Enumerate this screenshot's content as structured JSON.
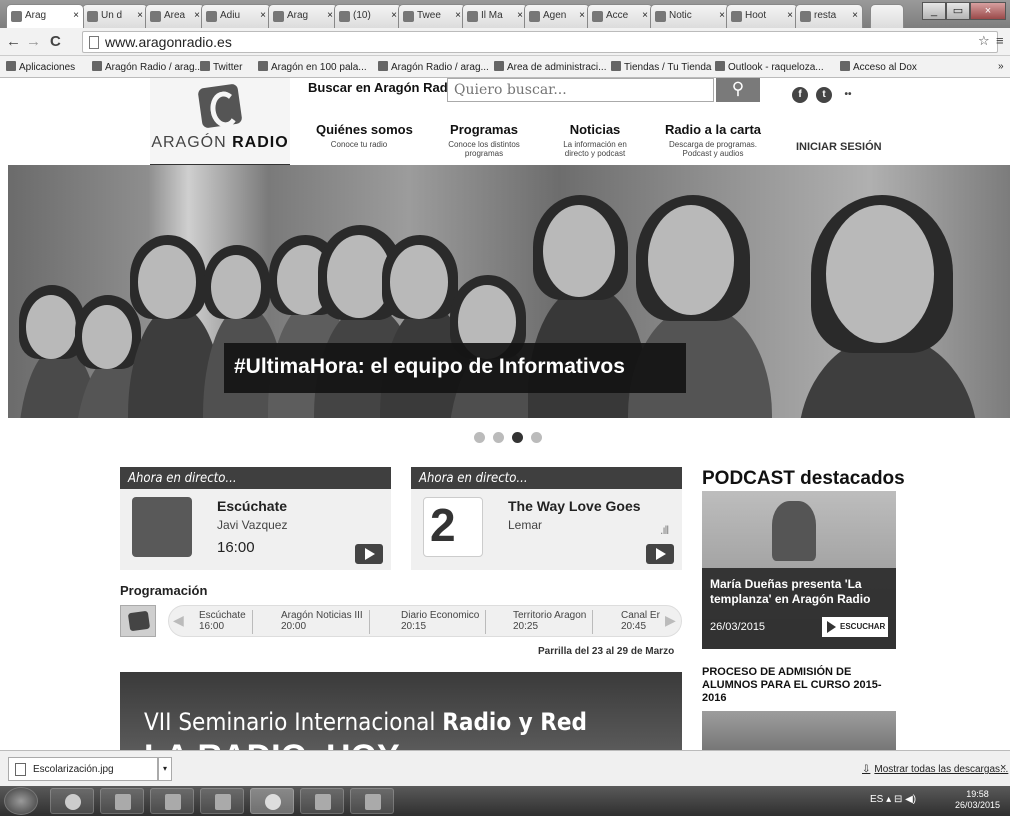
{
  "browser": {
    "tabs": [
      {
        "label": "Arag"
      },
      {
        "label": "Un d"
      },
      {
        "label": "Area"
      },
      {
        "label": "Adiu"
      },
      {
        "label": "Arag"
      },
      {
        "label": "(10)"
      },
      {
        "label": "Twee"
      },
      {
        "label": "Il Ma"
      },
      {
        "label": "Agen"
      },
      {
        "label": "Acce"
      },
      {
        "label": "Notic"
      },
      {
        "label": "Hoot"
      },
      {
        "label": "resta"
      }
    ],
    "url": "www.aragonradio.es",
    "bookmarks": [
      "Aplicaciones",
      "Aragón Radio / arag...",
      "Twitter",
      "Aragón en 100 pala...",
      "Aragón Radio / arag...",
      "Area de administraci...",
      "Tiendas / Tu Tienda",
      "Outlook - raqueloza...",
      "Acceso al Dox"
    ],
    "more_bookmarks": "»"
  },
  "site": {
    "logo": {
      "text_light": "ARAGÓN",
      "text_bold": "RADIO"
    },
    "search_label": "Buscar en Aragón Radio:",
    "search_placeholder": "Quiero buscar...",
    "social": [
      "f",
      "t",
      "••"
    ],
    "nav": [
      {
        "title": "Quiénes somos",
        "sub": "Conoce tu radio"
      },
      {
        "title": "Programas",
        "sub": "Conoce los distintos programas"
      },
      {
        "title": "Noticias",
        "sub": "La información en directo y podcast"
      },
      {
        "title": "Radio a la carta",
        "sub": "Descarga de programas. Podcast y audios"
      }
    ],
    "login": "INICIAR SESIÓN",
    "hero_caption": "#UltimaHora: el equipo de Informativos",
    "slider_active": 3,
    "live": [
      {
        "header": "Ahora en directo...",
        "title": "Escúchate",
        "sub": "Javi Vazquez",
        "time": "16:00"
      },
      {
        "header": "Ahora en directo...",
        "title": "The Way Love Goes",
        "sub": "Lemar",
        "time": ""
      }
    ],
    "podcast": {
      "heading": "PODCAST destacados",
      "title": "María Dueñas presenta 'La templanza' en Aragón Radio",
      "date": "26/03/2015",
      "button": "ESCUCHAR"
    },
    "programacion": {
      "heading": "Programación",
      "slots": [
        {
          "name": "Escúchate",
          "time": "16:00"
        },
        {
          "name": "Aragón Noticias III",
          "time": "20:00"
        },
        {
          "name": "Diario Economico",
          "time": "20:15"
        },
        {
          "name": "Territorio Aragon",
          "time": "20:25"
        },
        {
          "name": "Canal Er",
          "time": "20:45"
        }
      ],
      "grid_link": "Parrilla del 23 al 29 de Marzo"
    },
    "banner": {
      "line_light": "VII Seminario Internacional",
      "line_bold": "Radio y Red",
      "big": "LA RADIO, HOY"
    },
    "news_heading": "PROCESO DE ADMISIÓN DE ALUMNOS PARA EL CURSO 2015-2016"
  },
  "downloads": {
    "file": "Escolarización.jpg",
    "show_all": "Mostrar todas las descargas...",
    "close": "×"
  },
  "taskbar": {
    "lang": "ES",
    "time": "19:58",
    "date": "26/03/2015"
  }
}
